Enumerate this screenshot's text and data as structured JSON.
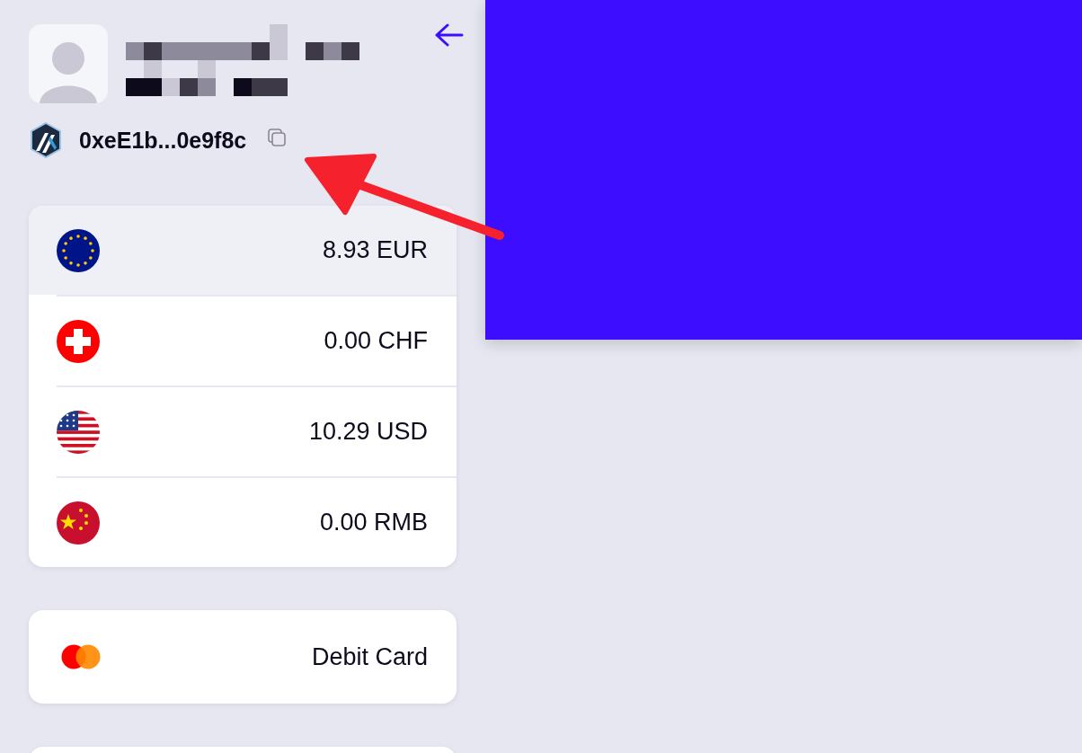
{
  "profile": {
    "address": "0xeE1b...0e9f8c"
  },
  "balances": [
    {
      "kind": "eu",
      "amount": "8.93 EUR",
      "selected": true
    },
    {
      "kind": "ch",
      "amount": "0.00 CHF",
      "selected": false
    },
    {
      "kind": "us",
      "amount": "10.29 USD",
      "selected": false
    },
    {
      "kind": "cn",
      "amount": "0.00 RMB",
      "selected": false
    }
  ],
  "cards": [
    {
      "kind": "mastercard",
      "label": "Debit Card"
    }
  ]
}
